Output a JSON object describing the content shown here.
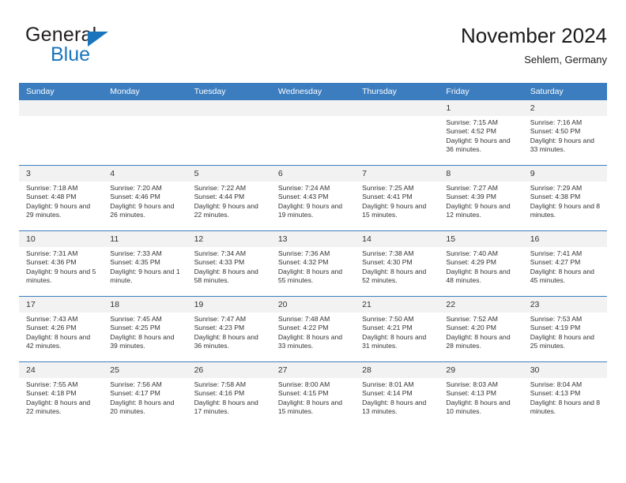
{
  "brand": {
    "name_part1": "General",
    "name_part2": "Blue",
    "logo_icon": "triangle-flag-icon"
  },
  "header": {
    "title": "November 2024",
    "subtitle": "Sehlem, Germany"
  },
  "colors": {
    "header_blue": "#3b7dbf",
    "brand_blue": "#1b75bc",
    "daynum_bg": "#f2f2f2",
    "text": "#333333"
  },
  "weekdays": [
    "Sunday",
    "Monday",
    "Tuesday",
    "Wednesday",
    "Thursday",
    "Friday",
    "Saturday"
  ],
  "weeks": [
    [
      {
        "day": "",
        "sunrise": "",
        "sunset": "",
        "daylight": "",
        "blank": true
      },
      {
        "day": "",
        "sunrise": "",
        "sunset": "",
        "daylight": "",
        "blank": true
      },
      {
        "day": "",
        "sunrise": "",
        "sunset": "",
        "daylight": "",
        "blank": true
      },
      {
        "day": "",
        "sunrise": "",
        "sunset": "",
        "daylight": "",
        "blank": true
      },
      {
        "day": "",
        "sunrise": "",
        "sunset": "",
        "daylight": "",
        "blank": true
      },
      {
        "day": "1",
        "sunrise": "Sunrise: 7:15 AM",
        "sunset": "Sunset: 4:52 PM",
        "daylight": "Daylight: 9 hours and 36 minutes.",
        "blank": false
      },
      {
        "day": "2",
        "sunrise": "Sunrise: 7:16 AM",
        "sunset": "Sunset: 4:50 PM",
        "daylight": "Daylight: 9 hours and 33 minutes.",
        "blank": false
      }
    ],
    [
      {
        "day": "3",
        "sunrise": "Sunrise: 7:18 AM",
        "sunset": "Sunset: 4:48 PM",
        "daylight": "Daylight: 9 hours and 29 minutes.",
        "blank": false
      },
      {
        "day": "4",
        "sunrise": "Sunrise: 7:20 AM",
        "sunset": "Sunset: 4:46 PM",
        "daylight": "Daylight: 9 hours and 26 minutes.",
        "blank": false
      },
      {
        "day": "5",
        "sunrise": "Sunrise: 7:22 AM",
        "sunset": "Sunset: 4:44 PM",
        "daylight": "Daylight: 9 hours and 22 minutes.",
        "blank": false
      },
      {
        "day": "6",
        "sunrise": "Sunrise: 7:24 AM",
        "sunset": "Sunset: 4:43 PM",
        "daylight": "Daylight: 9 hours and 19 minutes.",
        "blank": false
      },
      {
        "day": "7",
        "sunrise": "Sunrise: 7:25 AM",
        "sunset": "Sunset: 4:41 PM",
        "daylight": "Daylight: 9 hours and 15 minutes.",
        "blank": false
      },
      {
        "day": "8",
        "sunrise": "Sunrise: 7:27 AM",
        "sunset": "Sunset: 4:39 PM",
        "daylight": "Daylight: 9 hours and 12 minutes.",
        "blank": false
      },
      {
        "day": "9",
        "sunrise": "Sunrise: 7:29 AM",
        "sunset": "Sunset: 4:38 PM",
        "daylight": "Daylight: 9 hours and 8 minutes.",
        "blank": false
      }
    ],
    [
      {
        "day": "10",
        "sunrise": "Sunrise: 7:31 AM",
        "sunset": "Sunset: 4:36 PM",
        "daylight": "Daylight: 9 hours and 5 minutes.",
        "blank": false
      },
      {
        "day": "11",
        "sunrise": "Sunrise: 7:33 AM",
        "sunset": "Sunset: 4:35 PM",
        "daylight": "Daylight: 9 hours and 1 minute.",
        "blank": false
      },
      {
        "day": "12",
        "sunrise": "Sunrise: 7:34 AM",
        "sunset": "Sunset: 4:33 PM",
        "daylight": "Daylight: 8 hours and 58 minutes.",
        "blank": false
      },
      {
        "day": "13",
        "sunrise": "Sunrise: 7:36 AM",
        "sunset": "Sunset: 4:32 PM",
        "daylight": "Daylight: 8 hours and 55 minutes.",
        "blank": false
      },
      {
        "day": "14",
        "sunrise": "Sunrise: 7:38 AM",
        "sunset": "Sunset: 4:30 PM",
        "daylight": "Daylight: 8 hours and 52 minutes.",
        "blank": false
      },
      {
        "day": "15",
        "sunrise": "Sunrise: 7:40 AM",
        "sunset": "Sunset: 4:29 PM",
        "daylight": "Daylight: 8 hours and 48 minutes.",
        "blank": false
      },
      {
        "day": "16",
        "sunrise": "Sunrise: 7:41 AM",
        "sunset": "Sunset: 4:27 PM",
        "daylight": "Daylight: 8 hours and 45 minutes.",
        "blank": false
      }
    ],
    [
      {
        "day": "17",
        "sunrise": "Sunrise: 7:43 AM",
        "sunset": "Sunset: 4:26 PM",
        "daylight": "Daylight: 8 hours and 42 minutes.",
        "blank": false
      },
      {
        "day": "18",
        "sunrise": "Sunrise: 7:45 AM",
        "sunset": "Sunset: 4:25 PM",
        "daylight": "Daylight: 8 hours and 39 minutes.",
        "blank": false
      },
      {
        "day": "19",
        "sunrise": "Sunrise: 7:47 AM",
        "sunset": "Sunset: 4:23 PM",
        "daylight": "Daylight: 8 hours and 36 minutes.",
        "blank": false
      },
      {
        "day": "20",
        "sunrise": "Sunrise: 7:48 AM",
        "sunset": "Sunset: 4:22 PM",
        "daylight": "Daylight: 8 hours and 33 minutes.",
        "blank": false
      },
      {
        "day": "21",
        "sunrise": "Sunrise: 7:50 AM",
        "sunset": "Sunset: 4:21 PM",
        "daylight": "Daylight: 8 hours and 31 minutes.",
        "blank": false
      },
      {
        "day": "22",
        "sunrise": "Sunrise: 7:52 AM",
        "sunset": "Sunset: 4:20 PM",
        "daylight": "Daylight: 8 hours and 28 minutes.",
        "blank": false
      },
      {
        "day": "23",
        "sunrise": "Sunrise: 7:53 AM",
        "sunset": "Sunset: 4:19 PM",
        "daylight": "Daylight: 8 hours and 25 minutes.",
        "blank": false
      }
    ],
    [
      {
        "day": "24",
        "sunrise": "Sunrise: 7:55 AM",
        "sunset": "Sunset: 4:18 PM",
        "daylight": "Daylight: 8 hours and 22 minutes.",
        "blank": false
      },
      {
        "day": "25",
        "sunrise": "Sunrise: 7:56 AM",
        "sunset": "Sunset: 4:17 PM",
        "daylight": "Daylight: 8 hours and 20 minutes.",
        "blank": false
      },
      {
        "day": "26",
        "sunrise": "Sunrise: 7:58 AM",
        "sunset": "Sunset: 4:16 PM",
        "daylight": "Daylight: 8 hours and 17 minutes.",
        "blank": false
      },
      {
        "day": "27",
        "sunrise": "Sunrise: 8:00 AM",
        "sunset": "Sunset: 4:15 PM",
        "daylight": "Daylight: 8 hours and 15 minutes.",
        "blank": false
      },
      {
        "day": "28",
        "sunrise": "Sunrise: 8:01 AM",
        "sunset": "Sunset: 4:14 PM",
        "daylight": "Daylight: 8 hours and 13 minutes.",
        "blank": false
      },
      {
        "day": "29",
        "sunrise": "Sunrise: 8:03 AM",
        "sunset": "Sunset: 4:13 PM",
        "daylight": "Daylight: 8 hours and 10 minutes.",
        "blank": false
      },
      {
        "day": "30",
        "sunrise": "Sunrise: 8:04 AM",
        "sunset": "Sunset: 4:13 PM",
        "daylight": "Daylight: 8 hours and 8 minutes.",
        "blank": false
      }
    ]
  ]
}
